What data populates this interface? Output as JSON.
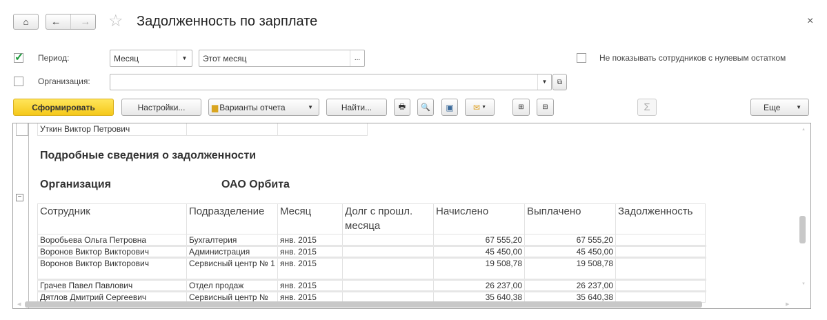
{
  "header": {
    "title": "Задолженность по зарплате",
    "close": "×"
  },
  "filters": {
    "period_label": "Период:",
    "period_type": "Месяц",
    "period_value": "Этот месяц",
    "period_more": "...",
    "org_label": "Организация:",
    "org_value": "",
    "hide_zero_label": "Не показывать сотрудников с нулевым остатком"
  },
  "toolbar": {
    "generate": "Сформировать",
    "settings": "Настройки...",
    "variants": "Варианты отчета",
    "find": "Найти...",
    "more": "Еще",
    "sum": "Σ"
  },
  "report": {
    "prev_row": "Уткин Виктор Петрович",
    "section_title": "Подробные сведения о задолженности",
    "org_label": "Организация",
    "org_value": "ОАО Орбита",
    "columns": [
      "Сотрудник",
      "Подразделение",
      "Месяц",
      "Долг с прошл. месяца",
      "Начислено",
      "Выплачено",
      "Задолженность"
    ],
    "rows": [
      [
        "Воробьева Ольга Петровна",
        "Бухгалтерия",
        "янв. 2015",
        "",
        "67 555,20",
        "67 555,20",
        ""
      ],
      [
        "Воронов Виктор Викторович",
        "Администрация",
        "янв. 2015",
        "",
        "45 450,00",
        "45 450,00",
        ""
      ],
      [
        "Воронов Виктор Викторович",
        "Сервисный центр № 1",
        "янв. 2015",
        "",
        "19 508,78",
        "19 508,78",
        ""
      ],
      [
        "Грачев Павел Павлович",
        "Отдел продаж",
        "янв. 2015",
        "",
        "26 237,00",
        "26 237,00",
        ""
      ],
      [
        "Дятлов Дмитрий Сергеевич",
        "Сервисный центр №",
        "янв. 2015",
        "",
        "35 640,38",
        "35 640,38",
        ""
      ]
    ]
  }
}
